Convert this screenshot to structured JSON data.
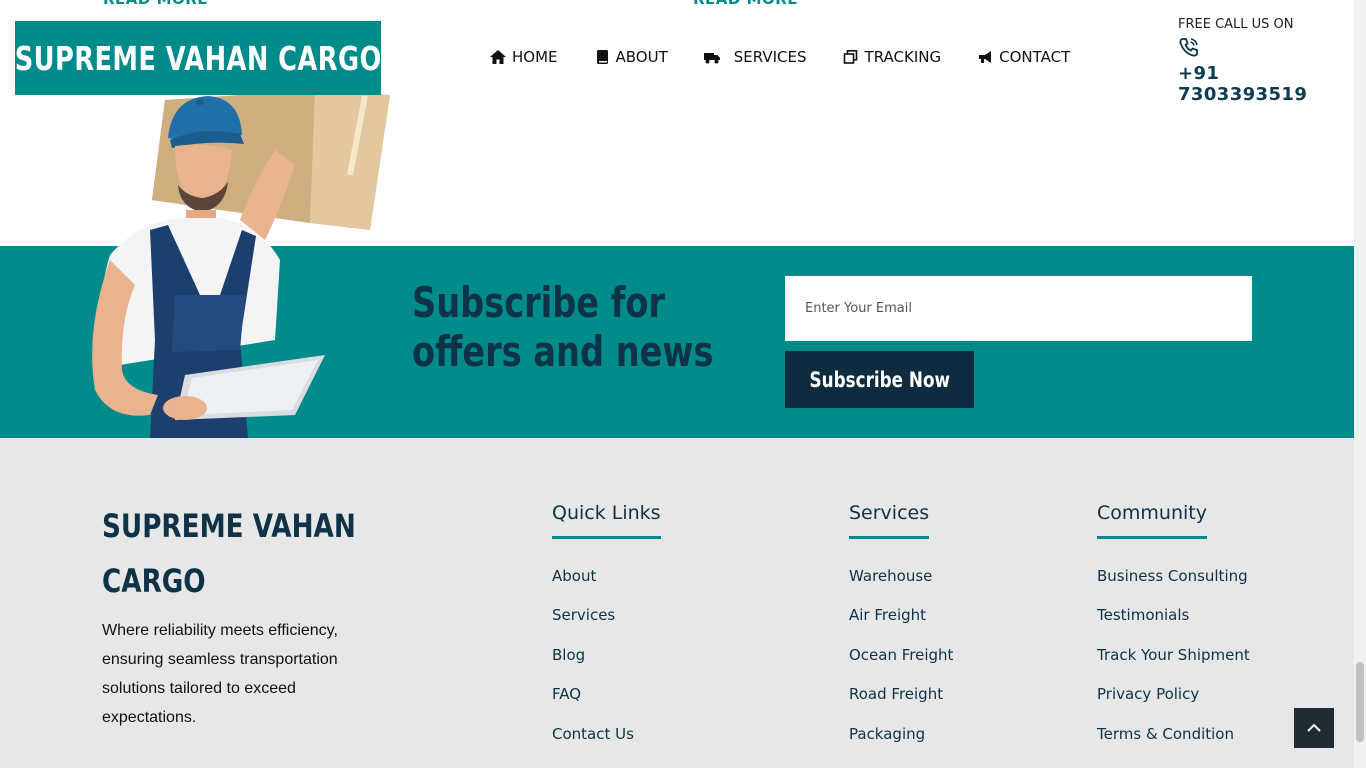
{
  "read_more": [
    "READ MORE",
    "READ MORE"
  ],
  "header": {
    "logo": "SUPREME VAHAN CARGO",
    "nav": [
      {
        "label": "HOME",
        "icon": "home-icon"
      },
      {
        "label": "ABOUT",
        "icon": "book-icon"
      },
      {
        "label": "SERVICES",
        "icon": "truck-icon"
      },
      {
        "label": "TRACKING",
        "icon": "copy-icon"
      },
      {
        "label": "CONTACT",
        "icon": "bullhorn-icon"
      }
    ],
    "call_label": "FREE CALL US ON",
    "call_icon": "phone-ringing-icon",
    "phone": "+91 7303393519"
  },
  "subscribe": {
    "title": "Subscribe for offers and news",
    "placeholder": "Enter Your Email",
    "button": "Subscribe Now"
  },
  "footer": {
    "brand": "SUPREME VAHAN CARGO",
    "description": "Where reliability meets efficiency, ensuring seamless transportation solutions tailored to exceed expectations.",
    "columns": [
      {
        "title": "Quick Links",
        "links": [
          "About",
          "Services",
          "Blog",
          "FAQ",
          "Contact Us"
        ]
      },
      {
        "title": "Services",
        "links": [
          "Warehouse",
          "Air Freight",
          "Ocean Freight",
          "Road Freight",
          "Packaging"
        ]
      },
      {
        "title": "Community",
        "links": [
          "Business Consulting",
          "Testimonials",
          "Track Your Shipment",
          "Privacy Policy",
          "Terms & Condition"
        ]
      }
    ]
  },
  "colors": {
    "teal": "#008b8b",
    "navy": "#0e3247",
    "footer_bg": "#e7e7e7"
  }
}
